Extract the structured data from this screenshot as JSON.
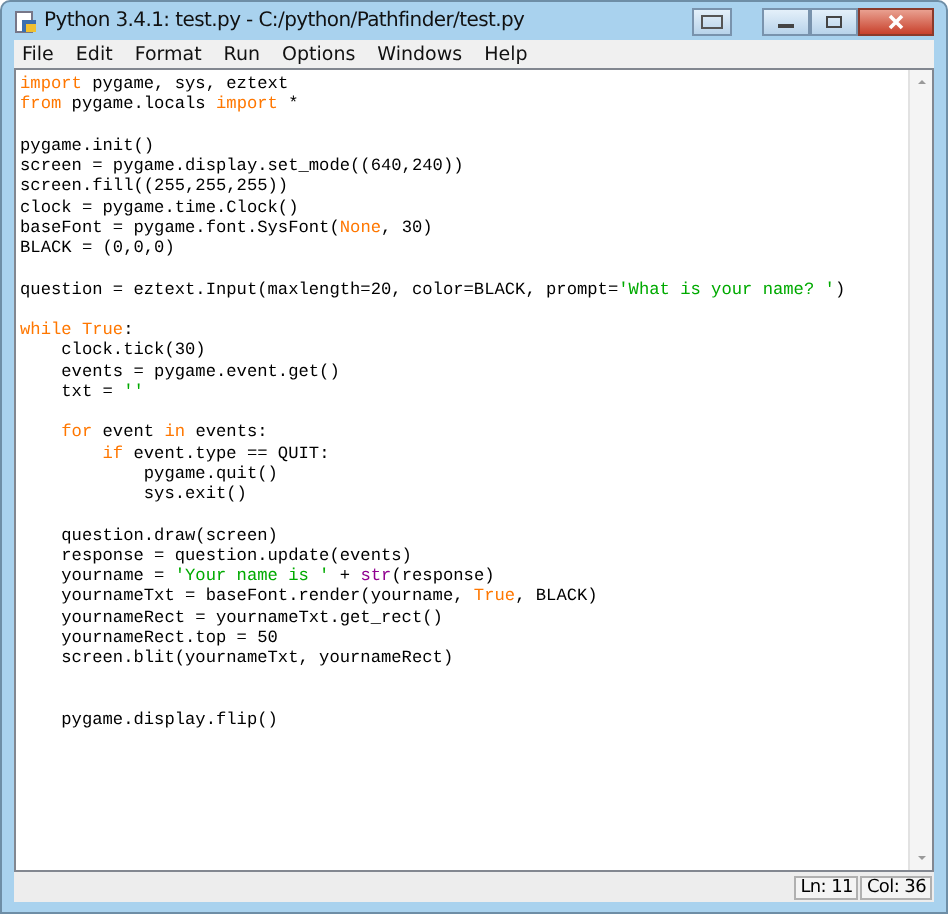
{
  "window": {
    "title": "Python 3.4.1: test.py - C:/python/Pathfinder/test.py"
  },
  "menu": [
    "File",
    "Edit",
    "Format",
    "Run",
    "Options",
    "Windows",
    "Help"
  ],
  "code_lines": [
    {
      "kind": "code",
      "segments": [
        {
          "text": "import",
          "kind": "keyword"
        },
        {
          "text": " pygame, sys, eztext",
          "kind": "plain"
        }
      ]
    },
    {
      "kind": "code",
      "segments": [
        {
          "text": "from",
          "kind": "keyword"
        },
        {
          "text": " pygame.locals ",
          "kind": "plain"
        },
        {
          "text": "import",
          "kind": "keyword"
        },
        {
          "text": " *",
          "kind": "plain"
        }
      ]
    },
    {
      "kind": "blank"
    },
    {
      "kind": "code",
      "segments": [
        {
          "text": "pygame.init()",
          "kind": "plain"
        }
      ]
    },
    {
      "kind": "code",
      "segments": [
        {
          "text": "screen = pygame.display.set_mode((640,240))",
          "kind": "plain"
        }
      ]
    },
    {
      "kind": "code",
      "segments": [
        {
          "text": "screen.fill((255,255,255))",
          "kind": "plain"
        }
      ]
    },
    {
      "kind": "code",
      "segments": [
        {
          "text": "clock = pygame.time.Clock()",
          "kind": "plain"
        }
      ]
    },
    {
      "kind": "code",
      "segments": [
        {
          "text": "baseFont = pygame.font.SysFont(",
          "kind": "plain"
        },
        {
          "text": "None",
          "kind": "keyword"
        },
        {
          "text": ", 30)",
          "kind": "plain"
        }
      ]
    },
    {
      "kind": "code",
      "segments": [
        {
          "text": "BLACK = (0,0,0)",
          "kind": "plain"
        }
      ]
    },
    {
      "kind": "blank"
    },
    {
      "kind": "code",
      "segments": [
        {
          "text": "question = eztext.Input(maxlength=20, color=BLACK, prompt=",
          "kind": "plain"
        },
        {
          "text": "'What is your name? '",
          "kind": "string"
        },
        {
          "text": ")",
          "kind": "plain"
        }
      ]
    },
    {
      "kind": "blank"
    },
    {
      "kind": "code",
      "segments": [
        {
          "text": "while True",
          "kind": "keyword"
        },
        {
          "text": ":",
          "kind": "plain"
        }
      ]
    },
    {
      "kind": "code",
      "segments": [
        {
          "text": "    clock.tick(30)",
          "kind": "plain"
        }
      ]
    },
    {
      "kind": "code",
      "segments": [
        {
          "text": "    events = pygame.event.get()",
          "kind": "plain"
        }
      ]
    },
    {
      "kind": "code",
      "segments": [
        {
          "text": "    txt = ",
          "kind": "plain"
        },
        {
          "text": "''",
          "kind": "string"
        }
      ]
    },
    {
      "kind": "blank"
    },
    {
      "kind": "code",
      "segments": [
        {
          "text": "    for",
          "kind": "keyword"
        },
        {
          "text": " event ",
          "kind": "plain"
        },
        {
          "text": "in",
          "kind": "keyword"
        },
        {
          "text": " events:",
          "kind": "plain"
        }
      ]
    },
    {
      "kind": "code",
      "segments": [
        {
          "text": "        if",
          "kind": "keyword"
        },
        {
          "text": " event.type == QUIT:",
          "kind": "plain"
        }
      ]
    },
    {
      "kind": "code",
      "segments": [
        {
          "text": "            pygame.quit()",
          "kind": "plain"
        }
      ]
    },
    {
      "kind": "code",
      "segments": [
        {
          "text": "            sys.exit()",
          "kind": "plain"
        }
      ]
    },
    {
      "kind": "blank"
    },
    {
      "kind": "code",
      "segments": [
        {
          "text": "    question.draw(screen)",
          "kind": "plain"
        }
      ]
    },
    {
      "kind": "code",
      "segments": [
        {
          "text": "    response = question.update(events)",
          "kind": "plain"
        }
      ]
    },
    {
      "kind": "code",
      "segments": [
        {
          "text": "    yourname = ",
          "kind": "plain"
        },
        {
          "text": "'Your name is '",
          "kind": "string"
        },
        {
          "text": " + ",
          "kind": "plain"
        },
        {
          "text": "str",
          "kind": "builtin"
        },
        {
          "text": "(response)",
          "kind": "plain"
        }
      ]
    },
    {
      "kind": "code",
      "segments": [
        {
          "text": "    yournameTxt = baseFont.render(yourname, ",
          "kind": "plain"
        },
        {
          "text": "True",
          "kind": "keyword"
        },
        {
          "text": ", BLACK)",
          "kind": "plain"
        }
      ]
    },
    {
      "kind": "code",
      "segments": [
        {
          "text": "    yournameRect = yournameTxt.get_rect()",
          "kind": "plain"
        }
      ]
    },
    {
      "kind": "code",
      "segments": [
        {
          "text": "    yournameRect.top = 50",
          "kind": "plain"
        }
      ]
    },
    {
      "kind": "code",
      "segments": [
        {
          "text": "    screen.blit(yournameTxt, yournameRect)",
          "kind": "plain"
        }
      ]
    },
    {
      "kind": "blank"
    },
    {
      "kind": "blank"
    },
    {
      "kind": "code",
      "segments": [
        {
          "text": "    pygame.display.flip()",
          "kind": "plain"
        }
      ]
    }
  ],
  "status_bar": {
    "line": "Ln: 11",
    "column": "Col: 36"
  }
}
